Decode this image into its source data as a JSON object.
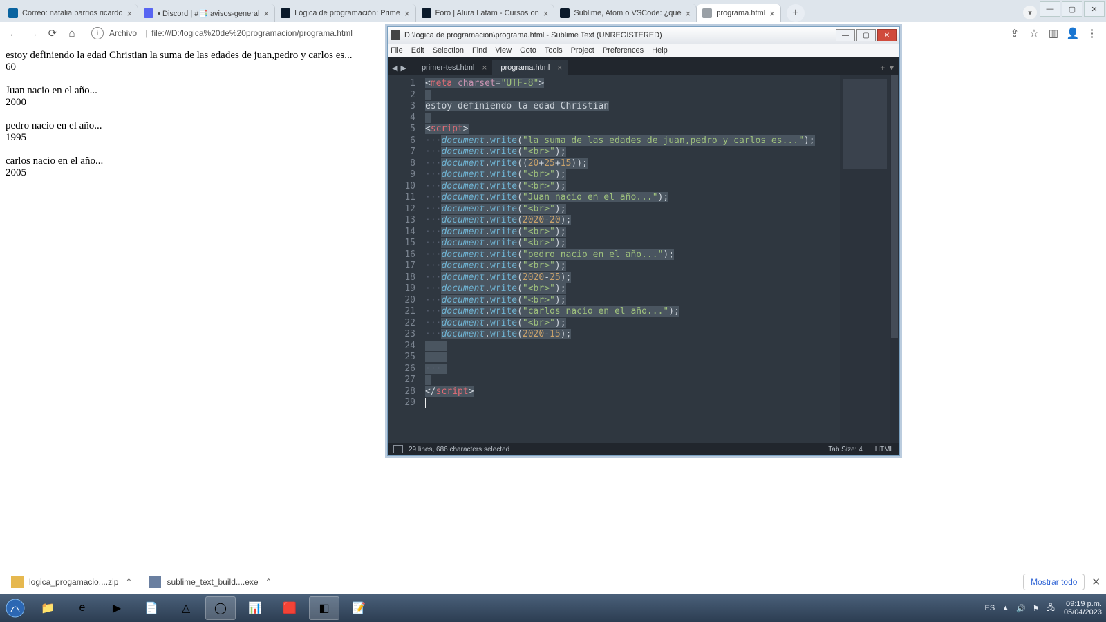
{
  "browser": {
    "tabs": [
      {
        "label": "Correo: natalia barrios ricardo",
        "favicon": "#0a64a0"
      },
      {
        "label": "• Discord | #📑|avisos-general",
        "favicon": "#5865f2"
      },
      {
        "label": "Lógica de programación: Prime",
        "favicon": "#0b1a2b"
      },
      {
        "label": "Foro | Alura Latam - Cursos on",
        "favicon": "#0b1a2b"
      },
      {
        "label": "Sublime, Atom o VSCode: ¿qué",
        "favicon": "#0b1a2b"
      },
      {
        "label": "programa.html",
        "favicon": "#9aa0a6",
        "active": true
      }
    ],
    "address": {
      "scheme": "Archivo",
      "path": "file:///D:/logica%20de%20programacion/programa.html"
    }
  },
  "page": {
    "l1": "estoy definiendo la edad Christian la suma de las edades de juan,pedro y carlos es...",
    "l2": "60",
    "l3": "Juan nacio en el año...",
    "l4": "2000",
    "l5": "pedro nacio en el año...",
    "l6": "1995",
    "l7": "carlos nacio en el año...",
    "l8": "2005"
  },
  "downloads": {
    "i1": "logica_progamacio....zip",
    "i2": "sublime_text_build....exe",
    "showall": "Mostrar todo"
  },
  "sublime": {
    "title": "D:\\logica de programacion\\programa.html - Sublime Text (UNREGISTERED)",
    "menu": [
      "File",
      "Edit",
      "Selection",
      "Find",
      "View",
      "Goto",
      "Tools",
      "Project",
      "Preferences",
      "Help"
    ],
    "tabs": {
      "t1": "primer-test.html",
      "t2": "programa.html"
    },
    "status": {
      "left": "29 lines, 686 characters selected",
      "tab": "Tab Size: 4",
      "lang": "HTML"
    },
    "code": {
      "ln": [
        "1",
        "2",
        "3",
        "4",
        "5",
        "6",
        "7",
        "8",
        "9",
        "10",
        "11",
        "12",
        "13",
        "14",
        "15",
        "16",
        "17",
        "18",
        "19",
        "20",
        "21",
        "22",
        "23",
        "24",
        "25",
        "26",
        "27",
        "28",
        "29"
      ],
      "meta_open": "<",
      "meta_tag": "meta",
      "sp": " ",
      "charset_attr": "charset",
      "eq": "=",
      "utf8": "\"UTF-8\"",
      "meta_close": ">",
      "txt": "estoy definiendo la edad Christian",
      "scr_open_a": "<",
      "scr_tag": "script",
      "scr_open_b": ">",
      "doc": "document",
      "dot": ".",
      "write": "write",
      "op": "(",
      "cp": ")",
      ";": ";",
      "s_sum": "\"la suma de las edades de juan,pedro y carlos es...\"",
      "s_br": "\"<br>\"",
      "n_sum_a": "20",
      "plus": "+",
      "n_sum_b": "25",
      "n_sum_c": "15",
      "s_juan": "\"Juan nacio en el año...\"",
      "n2020": "2020",
      "minus": "-",
      "n20": "20",
      "n25": "25",
      "n15": "15",
      "s_pedro": "\"pedro nacio en el año...\"",
      "s_carlos": "\"carlos nacio en el año...\"",
      "scr_close_a": "</",
      "scr_close_b": ">",
      "dots": "···"
    }
  },
  "tray": {
    "lang": "ES",
    "time": "09:19 p.m.",
    "date": "05/04/2023"
  }
}
